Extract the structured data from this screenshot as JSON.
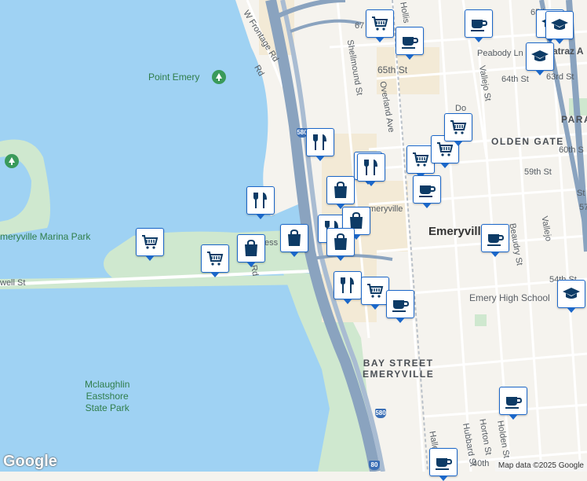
{
  "colors": {
    "water": "#9fd2f3",
    "land": "#f5f3ee",
    "park": "#cfe8cf",
    "commercial": "#f3ead6",
    "highway": "#8aa3bf",
    "road": "#ffffff",
    "pin_border": "#1b67c9",
    "pin_icon": "#0d3b66"
  },
  "labels": {
    "point_emery": "Point Emery",
    "emeryville_marina_park": "meryville Marina Park",
    "mclaughlin": "Mclaughlin\nEastshore\nState Park",
    "paradise": "PARA",
    "golden_gate": "OLDEN GATE",
    "bay_street": "BAY STREET\nEMERYVILLE",
    "emeryville_city": "Emeryville",
    "emeryville_small": "meryville",
    "emery_high_school": "Emery High School",
    "alcatraz": "atraz A",
    "w_frontage_rd": "W Frontage Rd",
    "shellmound_st": "Shellmound St",
    "overland_ave": "Overland Ave",
    "hollis": "Hollis",
    "st_65th": "65th St",
    "st_67": "67",
    "st_64th": "64th St",
    "st_63rd": "63rd St",
    "peabody_ln": "Peabody Ln",
    "vallejo_st_top": "Vallejo St",
    "vallejo_st_mid": "Vallejo",
    "beaudry_st": "Beaudry St",
    "st_60th": "60th S",
    "st_59th": "59th St",
    "st_54th": "54th St",
    "hubbard_st": "Hubbard St",
    "horton_st": "Horton St",
    "holden_st": "Holden St",
    "halle": "Halle",
    "st_40th": "40th",
    "st_57": "57",
    "st_st": "St",
    "do": "Do",
    "st_65_right": "65th",
    "powell": "well St",
    "access_rd": "ccess",
    "rd_vert": "s Rd",
    "rd_frontage": "Rd",
    "i580_top": "580",
    "i580_bottom": "580",
    "i80": "80"
  },
  "branding": {
    "logo": "Google",
    "attribution": "Map data ©2025 Google"
  },
  "pins": [
    {
      "type": "grocery",
      "name": "grocery-pin"
    },
    {
      "type": "cafe",
      "name": "cafe-pin"
    },
    {
      "type": "cafe",
      "name": "cafe-pin"
    },
    {
      "type": "school",
      "name": "school-pin"
    },
    {
      "type": "school",
      "name": "school-pin"
    },
    {
      "type": "restaurant",
      "name": "restaurant-pin"
    },
    {
      "type": "grocery",
      "name": "grocery-pin"
    },
    {
      "type": "grocery",
      "name": "grocery-pin"
    },
    {
      "type": "grocery",
      "name": "grocery-pin"
    },
    {
      "type": "grocery",
      "name": "grocery-pin"
    },
    {
      "type": "restaurant",
      "name": "restaurant-pin"
    },
    {
      "type": "shopping",
      "name": "shopping-pin"
    },
    {
      "type": "cafe",
      "name": "cafe-pin"
    },
    {
      "type": "restaurant",
      "name": "restaurant-pin"
    },
    {
      "type": "shopping",
      "name": "shopping-pin"
    },
    {
      "type": "restaurant",
      "name": "restaurant-pin"
    },
    {
      "type": "shopping",
      "name": "shopping-pin"
    },
    {
      "type": "shopping",
      "name": "shopping-pin"
    },
    {
      "type": "shopping",
      "name": "shopping-pin"
    },
    {
      "type": "grocery",
      "name": "grocery-pin"
    },
    {
      "type": "grocery",
      "name": "grocery-pin"
    },
    {
      "type": "cafe",
      "name": "cafe-pin"
    },
    {
      "type": "restaurant",
      "name": "restaurant-pin"
    },
    {
      "type": "grocery",
      "name": "grocery-pin"
    },
    {
      "type": "cafe",
      "name": "cafe-pin"
    },
    {
      "type": "cafe",
      "name": "cafe-pin"
    },
    {
      "type": "school",
      "name": "school-pin"
    },
    {
      "type": "school",
      "name": "school-pin"
    },
    {
      "type": "cafe",
      "name": "cafe-pin"
    }
  ]
}
